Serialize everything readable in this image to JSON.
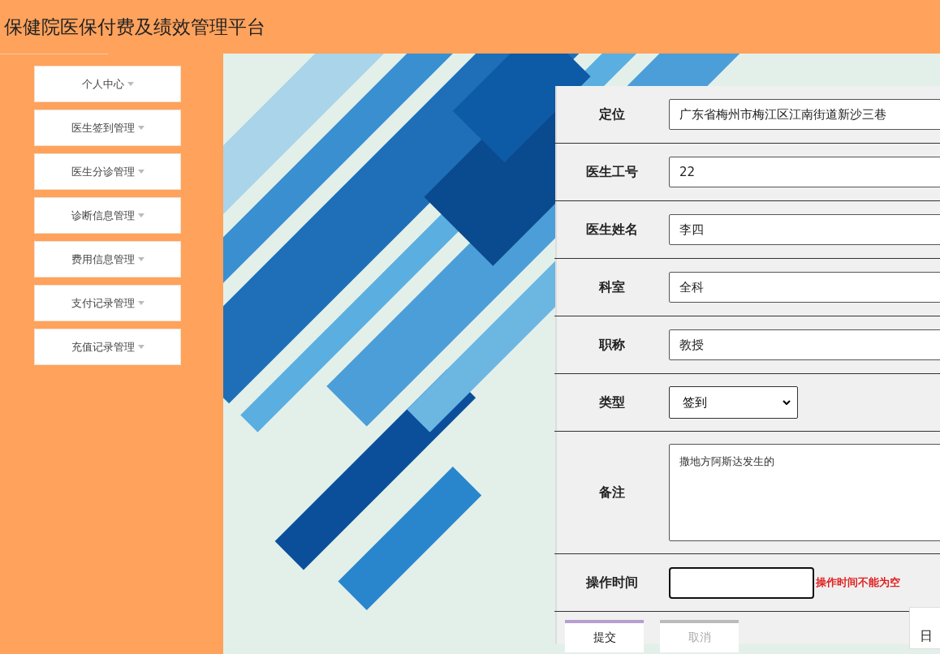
{
  "header": {
    "title": "保健院医保付费及绩效管理平台"
  },
  "sidebar": {
    "items": [
      {
        "label": "个人中心"
      },
      {
        "label": "医生签到管理"
      },
      {
        "label": "医生分诊管理"
      },
      {
        "label": "诊断信息管理"
      },
      {
        "label": "费用信息管理"
      },
      {
        "label": "支付记录管理"
      },
      {
        "label": "充值记录管理"
      }
    ]
  },
  "form": {
    "fields": [
      {
        "kind": "text",
        "label": "定位",
        "value": "广东省梅州市梅江区江南街道新沙三巷"
      },
      {
        "kind": "text",
        "label": "医生工号",
        "value": "22"
      },
      {
        "kind": "text",
        "label": "医生姓名",
        "value": "李四"
      },
      {
        "kind": "text",
        "label": "科室",
        "value": "全科"
      },
      {
        "kind": "text",
        "label": "职称",
        "value": "教授"
      },
      {
        "kind": "select",
        "label": "类型",
        "value": "签到"
      },
      {
        "kind": "textarea",
        "label": "备注",
        "value": "撒地方阿斯达发生的"
      },
      {
        "kind": "date",
        "label": "操作时间",
        "error": "操作时间不能为空"
      }
    ],
    "buttons": [
      {
        "label": "提交",
        "disabled": false
      },
      {
        "label": "取消",
        "disabled": true
      }
    ]
  },
  "date_popup": {
    "text": "日"
  }
}
